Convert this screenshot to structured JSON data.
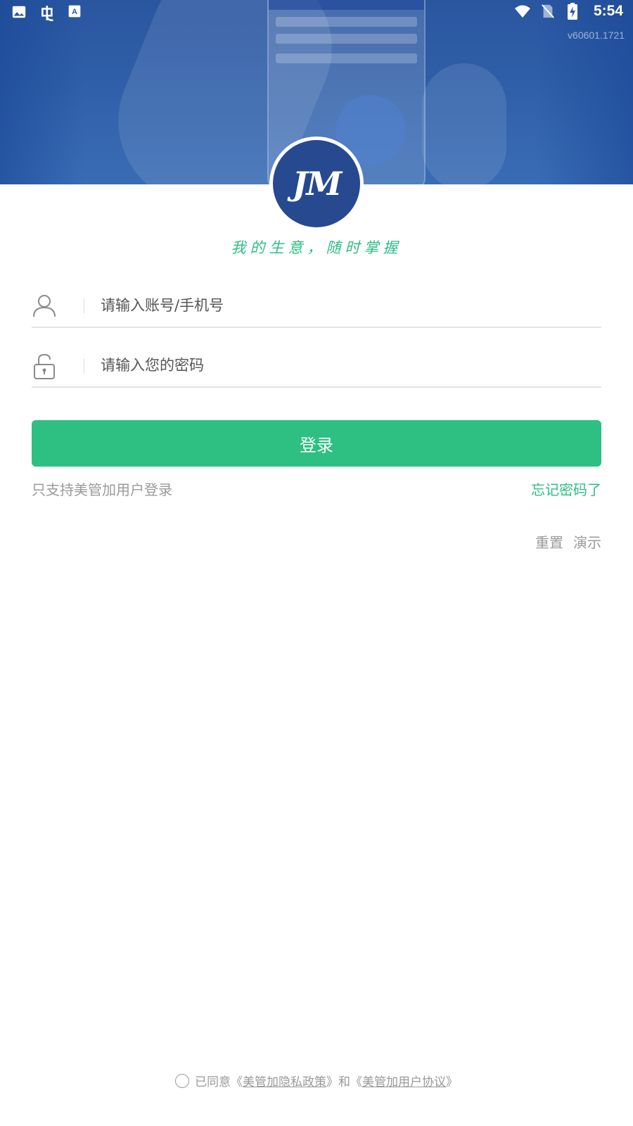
{
  "status_bar": {
    "time": "5:54",
    "left_icons": [
      "image-icon",
      "bug-icon",
      "text-recognition-icon"
    ],
    "right_icons": [
      "wifi-icon",
      "no-sim-icon",
      "battery-charging-icon"
    ]
  },
  "header": {
    "version": "v60601.1721",
    "logo_text": "JM",
    "slogan": "我的生意，随时掌握"
  },
  "form": {
    "account_placeholder": "请输入账号/手机号",
    "password_placeholder": "请输入您的密码",
    "login_label": "登录",
    "support_hint": "只支持美管加用户登录",
    "forgot_label": "忘记密码了",
    "reset_label": "重置",
    "demo_label": "演示"
  },
  "agreement": {
    "prefix": "已同意",
    "privacy_policy": "美管加隐私政策",
    "and": "和",
    "user_agreement": "美管加用户协议",
    "checked": false
  },
  "colors": {
    "brand_green": "#2ebf83",
    "brand_blue": "#26498f"
  }
}
